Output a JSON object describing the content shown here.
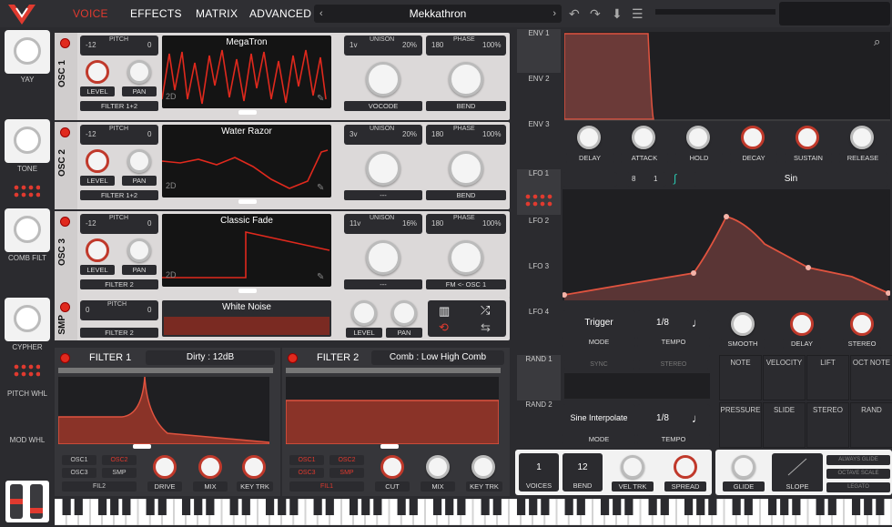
{
  "nav": {
    "tabs": [
      "VOICE",
      "EFFECTS",
      "MATRIX",
      "ADVANCED"
    ],
    "preset": "Mekkathron"
  },
  "macros": [
    {
      "label": "YAY"
    },
    {
      "label": "TONE"
    },
    {
      "label": "COMB FILT"
    },
    {
      "label": "CYPHER"
    }
  ],
  "wheels": {
    "pitch": "PITCH WHL",
    "mod": "MOD WHL"
  },
  "oscs": [
    {
      "name": "OSC 1",
      "pitch_lo": "-12",
      "pitch_label": "PITCH",
      "pitch_hi": "0",
      "wave": "MegaTron",
      "dim": "2D",
      "unison_v": "1v",
      "unison_label": "UNISON",
      "unison_pct": "20%",
      "phase_v": "180",
      "phase_label": "PHASE",
      "phase_pct": "100%",
      "filter": "FILTER 1+2",
      "mode": "VOCODE",
      "bend": "BEND",
      "level": "LEVEL",
      "pan": "PAN"
    },
    {
      "name": "OSC 2",
      "pitch_lo": "-12",
      "pitch_label": "PITCH",
      "pitch_hi": "0",
      "wave": "Water Razor",
      "dim": "2D",
      "unison_v": "3v",
      "unison_label": "UNISON",
      "unison_pct": "20%",
      "phase_v": "180",
      "phase_label": "PHASE",
      "phase_pct": "100%",
      "filter": "FILTER 1+2",
      "mode": "---",
      "bend": "BEND",
      "level": "LEVEL",
      "pan": "PAN"
    },
    {
      "name": "OSC 3",
      "pitch_lo": "-12",
      "pitch_label": "PITCH",
      "pitch_hi": "0",
      "wave": "Classic Fade",
      "dim": "2D",
      "unison_v": "11v",
      "unison_label": "UNISON",
      "unison_pct": "16%",
      "phase_v": "180",
      "phase_label": "PHASE",
      "phase_pct": "100%",
      "filter": "FILTER 2",
      "mode": "---",
      "bend": "FM <- OSC 1",
      "level": "LEVEL",
      "pan": "PAN"
    }
  ],
  "smp": {
    "name": "SMP",
    "pitch_lo": "0",
    "pitch_label": "PITCH",
    "pitch_hi": "0",
    "filter": "FILTER 2",
    "sample": "White Noise",
    "level": "LEVEL",
    "pan": "PAN"
  },
  "filter1": {
    "title": "FILTER 1",
    "type": "Dirty : 12dB",
    "routes": [
      "OSC1",
      "OSC2",
      "OSC3",
      "SMP"
    ],
    "fil": "FIL2",
    "drive": "DRIVE",
    "mix": "MIX",
    "keytrk": "KEY TRK"
  },
  "filter2": {
    "title": "FILTER 2",
    "type": "Comb : Low High Comb",
    "routes": [
      "OSC1",
      "OSC2",
      "OSC3",
      "SMP"
    ],
    "fil": "FIL1",
    "cut": "CUT",
    "mix": "MIX",
    "keytrk": "KEY TRK"
  },
  "env": {
    "tabs": [
      "ENV 1",
      "ENV 2",
      "ENV 3"
    ],
    "knobs": [
      "DELAY",
      "ATTACK",
      "HOLD",
      "DECAY",
      "SUSTAIN",
      "RELEASE"
    ]
  },
  "lfo": {
    "tabs": [
      "LFO 1",
      "LFO 2",
      "LFO 3",
      "LFO 4"
    ],
    "grid_a": "8",
    "grid_b": "1",
    "shape": "Sin",
    "mode": "Trigger",
    "mode_label": "MODE",
    "tempo": "1/8",
    "tempo_label": "TEMPO",
    "smooth": "SMOOTH",
    "delay": "DELAY",
    "stereo": "STEREO"
  },
  "rand": {
    "tabs": [
      "RAND 1",
      "RAND 2"
    ],
    "sync": "SYNC",
    "stereo": "STEREO",
    "mode": "Sine Interpolate",
    "mode_label": "MODE",
    "tempo": "1/8",
    "tempo_label": "TEMPO"
  },
  "modsrc": [
    "NOTE",
    "VELOCITY",
    "LIFT",
    "OCT NOTE",
    "PRESSURE",
    "SLIDE",
    "STEREO",
    "RAND"
  ],
  "voice": {
    "voices": "1",
    "voices_label": "VOICES",
    "bend": "12",
    "bend_label": "BEND",
    "veltrk": "VEL TRK",
    "spread": "SPREAD",
    "glide": "GLIDE",
    "slope": "SLOPE",
    "always": "ALWAYS GLIDE",
    "octave": "OCTAVE SCALE",
    "legato": "LEGATO"
  },
  "accent": "#e03a2f"
}
